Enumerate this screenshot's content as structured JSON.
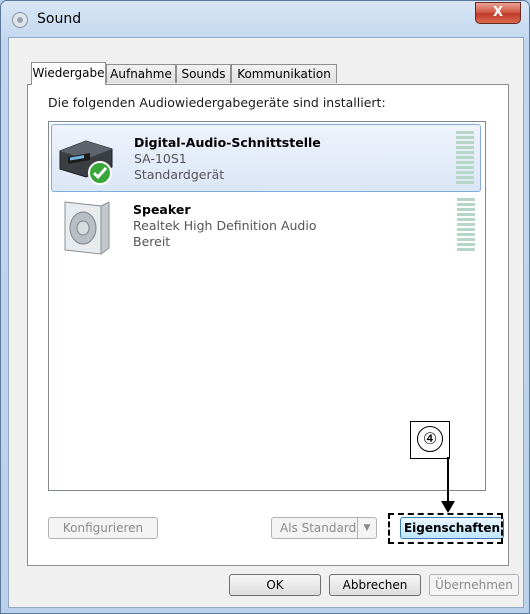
{
  "window": {
    "title": "Sound",
    "close_label": "X"
  },
  "tabs": [
    {
      "label": "Wiedergabe",
      "active": true
    },
    {
      "label": "Aufnahme",
      "active": false
    },
    {
      "label": "Sounds",
      "active": false
    },
    {
      "label": "Kommunikation",
      "active": false
    }
  ],
  "heading": "Die folgenden Audiowiedergabegeräte sind installiert:",
  "devices": [
    {
      "name": "Digital-Audio-Schnittstelle",
      "detail": "SA-10S1",
      "status": "Standardgerät",
      "icon": "receiver-icon",
      "selected": true,
      "default": true
    },
    {
      "name": "Speaker",
      "detail": "Realtek High Definition Audio",
      "status": "Bereit",
      "icon": "speaker-icon",
      "selected": false,
      "default": false
    }
  ],
  "buttons": {
    "configure": "Konfigurieren",
    "set_default": "Als Standard",
    "properties": "Eigenschaften",
    "ok": "OK",
    "cancel": "Abbrechen",
    "apply": "Übernehmen"
  },
  "callout": {
    "marker": "④"
  }
}
